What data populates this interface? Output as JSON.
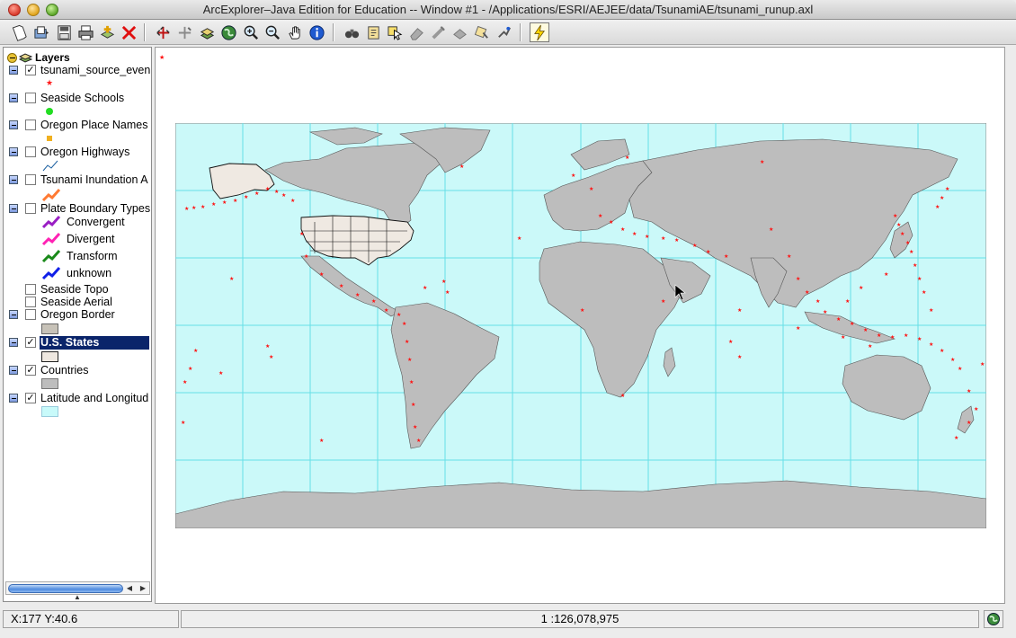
{
  "window": {
    "title": "ArcExplorer–Java Edition for Education -- Window #1 - /Applications/ESRI/AEJEE/data/TsunamiAE/tsunami_runup.axl"
  },
  "toolbar": {
    "tools": [
      "new-map",
      "open-project",
      "save-project",
      "print",
      "add-layer",
      "remove-layer",
      "zoom-to-full-extent",
      "zoom-to-active-layer",
      "zoom-to-selected",
      "zoom-previous",
      "zoom-in",
      "zoom-out",
      "pan",
      "identify",
      "find",
      "query-builder",
      "select",
      "clear-selection",
      "measure",
      "buffer",
      "spatial-query",
      "hyperlink",
      "lightning"
    ]
  },
  "toc": {
    "root_label": "Layers",
    "layers": [
      {
        "name": "tsunami_source_even",
        "checked": true
      },
      {
        "name": "Seaside Schools",
        "checked": false
      },
      {
        "name": "Oregon Place Names",
        "checked": false
      },
      {
        "name": "Oregon Highways",
        "checked": false
      },
      {
        "name": "Tsunami Inundation A",
        "checked": false
      },
      {
        "name": "Plate Boundary Types",
        "checked": false
      },
      {
        "name": "Seaside Topo",
        "checked": false
      },
      {
        "name": "Seaside Aerial",
        "checked": false
      },
      {
        "name": "Oregon Border",
        "checked": false
      },
      {
        "name": "U.S. States",
        "checked": true,
        "selected": true
      },
      {
        "name": "Countries",
        "checked": true
      },
      {
        "name": "Latitude and Longitud",
        "checked": true
      }
    ],
    "plate_boundary_legend": [
      {
        "label": "Convergent",
        "color": "#9a1fc4"
      },
      {
        "label": "Divergent",
        "color": "#ff22b4"
      },
      {
        "label": "Transform",
        "color": "#1a8a1a"
      },
      {
        "label": "unknown",
        "color": "#1020e8"
      }
    ],
    "symbol_colors": {
      "tsunami": "#ff1a1a",
      "schools": "#22dd22",
      "place_names": "#f0b020",
      "highways": "#1a5fa0",
      "inundation": "#ff7a33",
      "oregon_border": "#c7c2b8",
      "us_states": "#efe8e0",
      "countries": "#bdbdbd",
      "latlon": "#c8fafa"
    }
  },
  "map": {
    "ocean_color": "#cbf9f9",
    "land_color": "#bdbdbd",
    "us_color": "#efe9e2",
    "grid_color": "#66e0e6",
    "event_color": "#ff1010"
  },
  "status": {
    "coordinates": "X:177 Y:40.6",
    "scale": "1 :126,078,975"
  }
}
